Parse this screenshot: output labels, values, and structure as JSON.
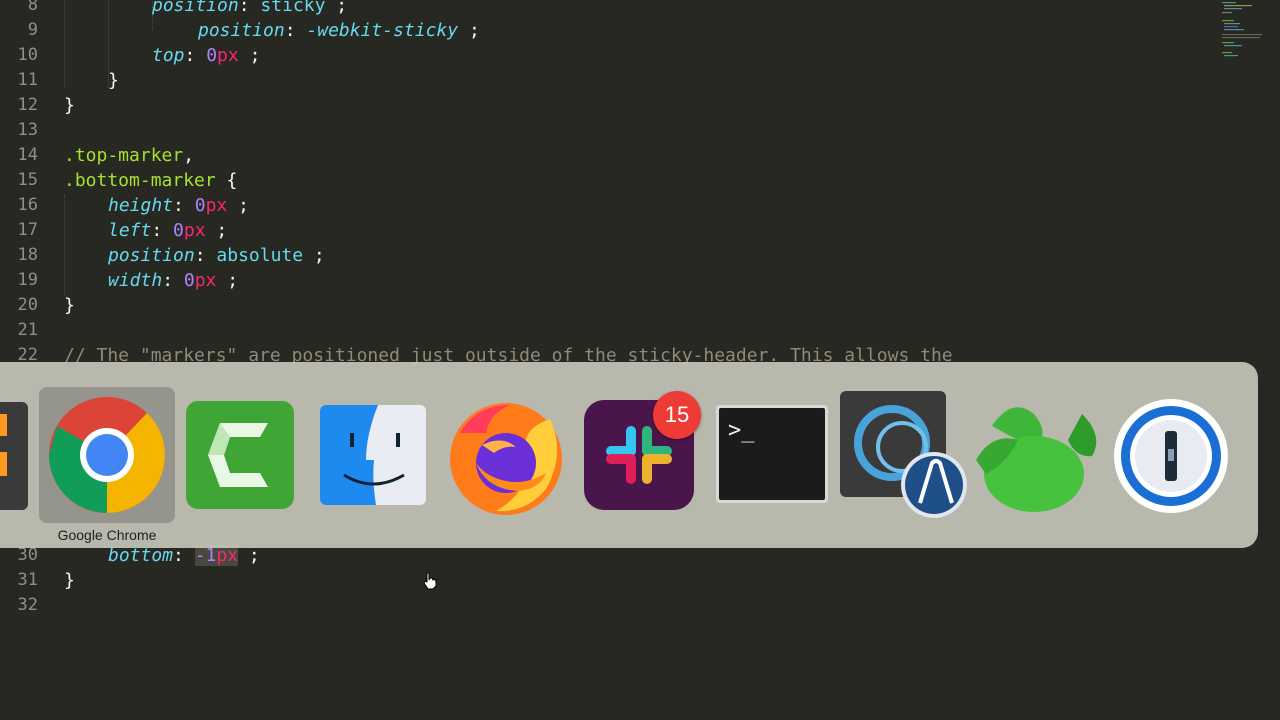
{
  "editor": {
    "lines": [
      {
        "n": "8",
        "segs": [
          [
            "prop",
            "position"
          ],
          [
            "punct",
            ": "
          ],
          [
            "val",
            "sticky"
          ],
          [
            "punct",
            " ;"
          ]
        ]
      },
      {
        "n": "9",
        "segs": [
          [
            "vend",
            "position"
          ],
          [
            "punct",
            ": "
          ],
          [
            "vend",
            "-webkit-sticky"
          ],
          [
            "punct",
            " ;"
          ]
        ]
      },
      {
        "n": "10",
        "segs": [
          [
            "prop",
            "top"
          ],
          [
            "punct",
            ": "
          ],
          [
            "num",
            "0"
          ],
          [
            "unit",
            "px"
          ],
          [
            "punct",
            " ;"
          ]
        ]
      },
      {
        "n": "11",
        "segs": [
          [
            "punct",
            "}"
          ]
        ]
      },
      {
        "n": "12",
        "segs": [
          [
            "punct",
            "}"
          ]
        ]
      },
      {
        "n": "13",
        "segs": []
      },
      {
        "n": "14",
        "segs": [
          [
            "sel",
            ".top-marker"
          ],
          [
            "punct",
            ","
          ]
        ]
      },
      {
        "n": "15",
        "segs": [
          [
            "sel",
            ".bottom-marker"
          ],
          [
            "punct",
            " {"
          ]
        ]
      },
      {
        "n": "16",
        "segs": [
          [
            "prop",
            "height"
          ],
          [
            "punct",
            ": "
          ],
          [
            "num",
            "0"
          ],
          [
            "unit",
            "px"
          ],
          [
            "punct",
            " ;"
          ]
        ]
      },
      {
        "n": "17",
        "segs": [
          [
            "prop",
            "left"
          ],
          [
            "punct",
            ": "
          ],
          [
            "num",
            "0"
          ],
          [
            "unit",
            "px"
          ],
          [
            "punct",
            " ;"
          ]
        ]
      },
      {
        "n": "18",
        "segs": [
          [
            "prop",
            "position"
          ],
          [
            "punct",
            ": "
          ],
          [
            "val",
            "absolute"
          ],
          [
            "punct",
            " ;"
          ]
        ]
      },
      {
        "n": "19",
        "segs": [
          [
            "prop",
            "width"
          ],
          [
            "punct",
            ": "
          ],
          [
            "num",
            "0"
          ],
          [
            "unit",
            "px"
          ],
          [
            "punct",
            " ;"
          ]
        ]
      },
      {
        "n": "20",
        "segs": [
          [
            "punct",
            "}"
          ]
        ]
      },
      {
        "n": "21",
        "segs": []
      },
      {
        "n": "22",
        "segs": [
          [
            "cmt",
            "// The \"markers\" are positioned just outside of the sticky-header. This allows the"
          ]
        ]
      },
      {
        "n": "30",
        "segs": [
          [
            "prop",
            "bottom"
          ],
          [
            "punct",
            ": "
          ],
          [
            "num",
            "-1"
          ],
          [
            "unit",
            "px"
          ],
          [
            "punct",
            " ;"
          ]
        ]
      },
      {
        "n": "31",
        "segs": [
          [
            "punct",
            "}"
          ]
        ]
      },
      {
        "n": "32",
        "segs": []
      }
    ]
  },
  "dock": {
    "selected_label": "Google Chrome",
    "apps": [
      "partial-app-icon",
      "chrome-icon",
      "camtasia-icon",
      "finder-icon",
      "firefox-icon",
      "slack-icon",
      "terminal-icon",
      "cloud-app-icon",
      "paw-icon",
      "onepassword-icon"
    ],
    "slack_badge": "15",
    "terminal_prompt": ">_"
  },
  "colors": {
    "editor_bg": "#272822",
    "selector": "#a6e22e",
    "property": "#66d9ef",
    "number": "#ae81ff",
    "unit": "#f92672",
    "comment": "#8f8b78",
    "badge": "#ee3b36"
  }
}
